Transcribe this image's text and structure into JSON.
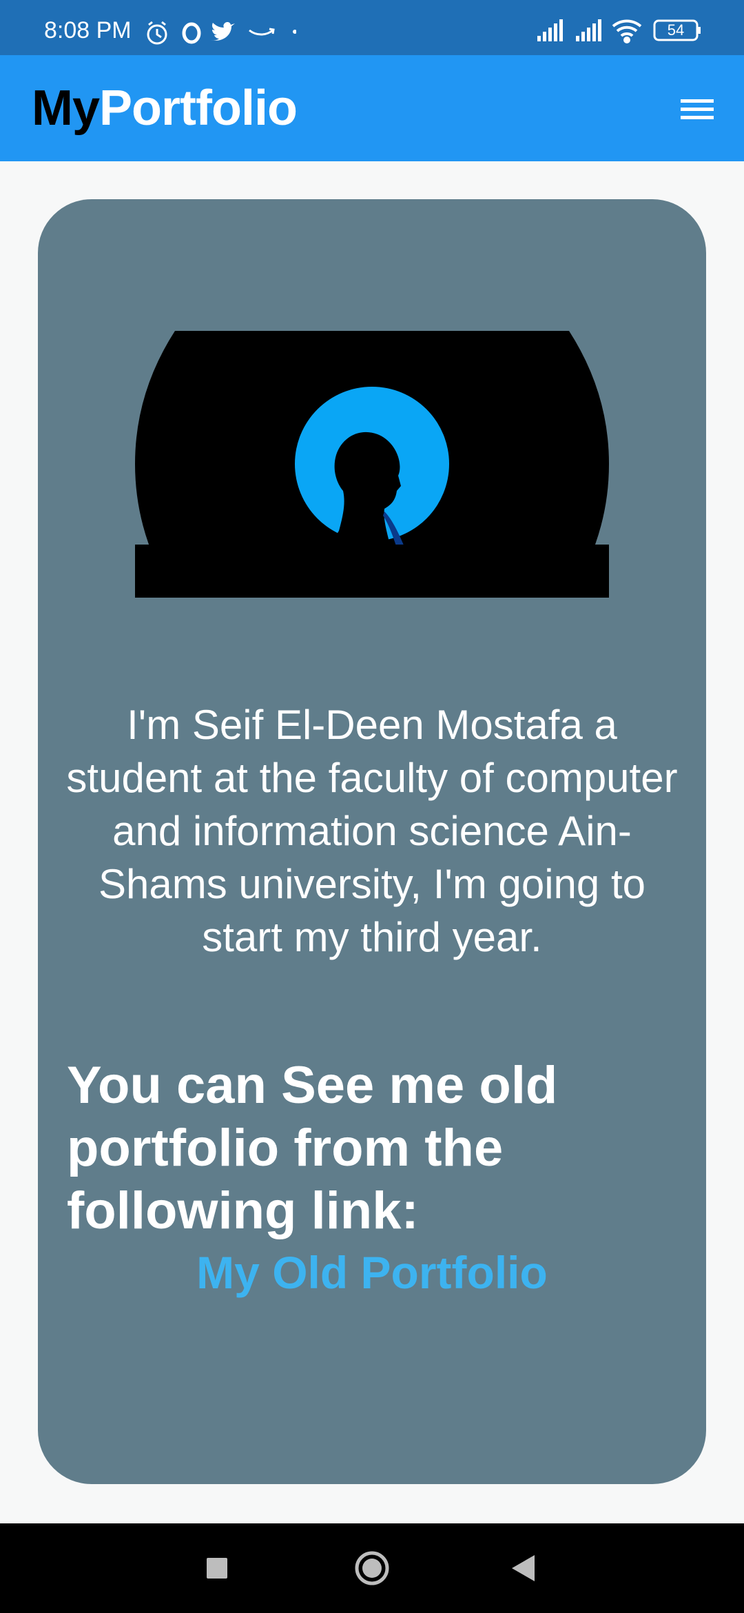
{
  "status_bar": {
    "time": "8:08 PM",
    "battery_level": "54",
    "icons": [
      "alarm-icon",
      "opera-icon",
      "twitter-icon",
      "amazon-icon",
      "dot-icon",
      "signal-icon",
      "signal-icon",
      "wifi-icon",
      "battery-icon"
    ]
  },
  "app_bar": {
    "brand_prefix": "My",
    "brand_suffix": "Portfolio",
    "menu_icon": "hamburger-menu-icon",
    "color": "#2196f3"
  },
  "profile": {
    "avatar_icon": "profile-silhouette-image",
    "bio": "I'm Seif El-Deen Mostafa a student at the faculty of computer and information science Ain-Shams university, I'm going to start my third year.",
    "cta": "You can See me old portfolio from the following link:",
    "link_label": "My Old Portfolio",
    "card_color": "#607d8b",
    "link_color": "#3db3f0"
  },
  "nav_bar": {
    "buttons": [
      "recent-apps-icon",
      "home-icon",
      "back-icon"
    ]
  }
}
